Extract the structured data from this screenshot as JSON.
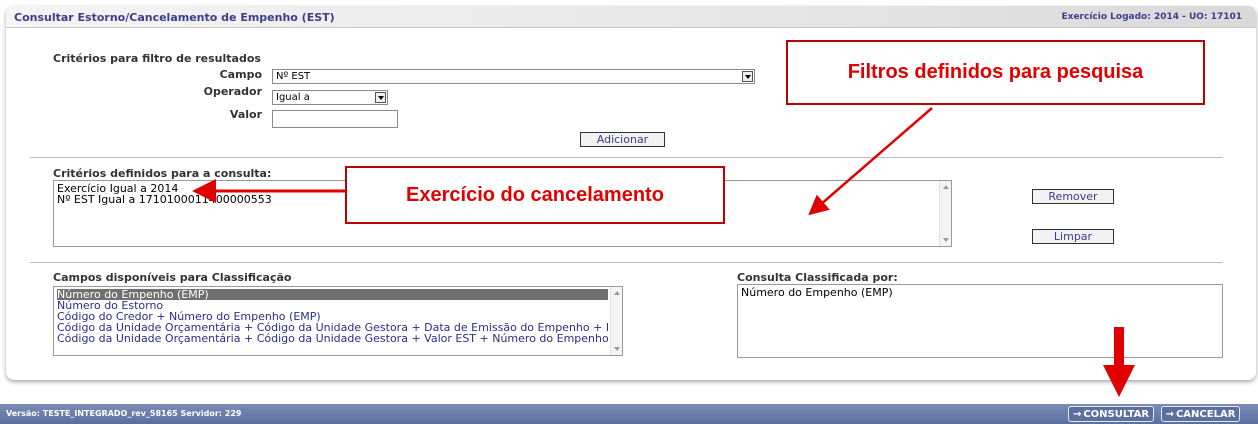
{
  "header": {
    "title": "Consultar Estorno/Cancelamento de Empenho (EST)",
    "exercise_info": "Exercício Logado: 2014 - UO: 17101"
  },
  "filter": {
    "section_label": "Critérios para filtro de resultados",
    "campo_label": "Campo",
    "campo_value": "Nº EST",
    "operador_label": "Operador",
    "operador_value": "Igual a",
    "valor_label": "Valor",
    "valor_value": "",
    "add_button": "Adicionar"
  },
  "criteria": {
    "section_label": "Critérios definidos para a consulta:",
    "items": [
      "Exercício Igual a 2014",
      "Nº EST Igual a 1710100011400000553"
    ],
    "remove_button": "Remover",
    "clear_button": "Limpar"
  },
  "classification": {
    "available_label": "Campos disponíveis para Classificação",
    "available_items": [
      "Número do Empenho (EMP)",
      "Número do Estorno",
      "Código do Credor + Número do Empenho (EMP)",
      "Código da Unidade Orçamentária + Código da Unidade Gestora + Data de Emissão do Empenho + Número do Empenho (EMP)",
      "Código da Unidade Orçamentária + Código da Unidade Gestora + Valor EST + Número do Empenho (EMP)"
    ],
    "selected_index": 0,
    "sorted_label": "Consulta Classificada por:",
    "sorted_items": [
      "Número do Empenho (EMP)"
    ]
  },
  "annotations": {
    "filters_callout": "Filtros definidos para pesquisa",
    "exercise_callout": "Exercício do cancelamento",
    "color": "#e00000"
  },
  "footer": {
    "version_text": "Versão: TESTE_INTEGRADO_rev_58165   Servidor: 229",
    "consultar_button": "CONSULTAR",
    "cancelar_button": "CANCELAR"
  }
}
